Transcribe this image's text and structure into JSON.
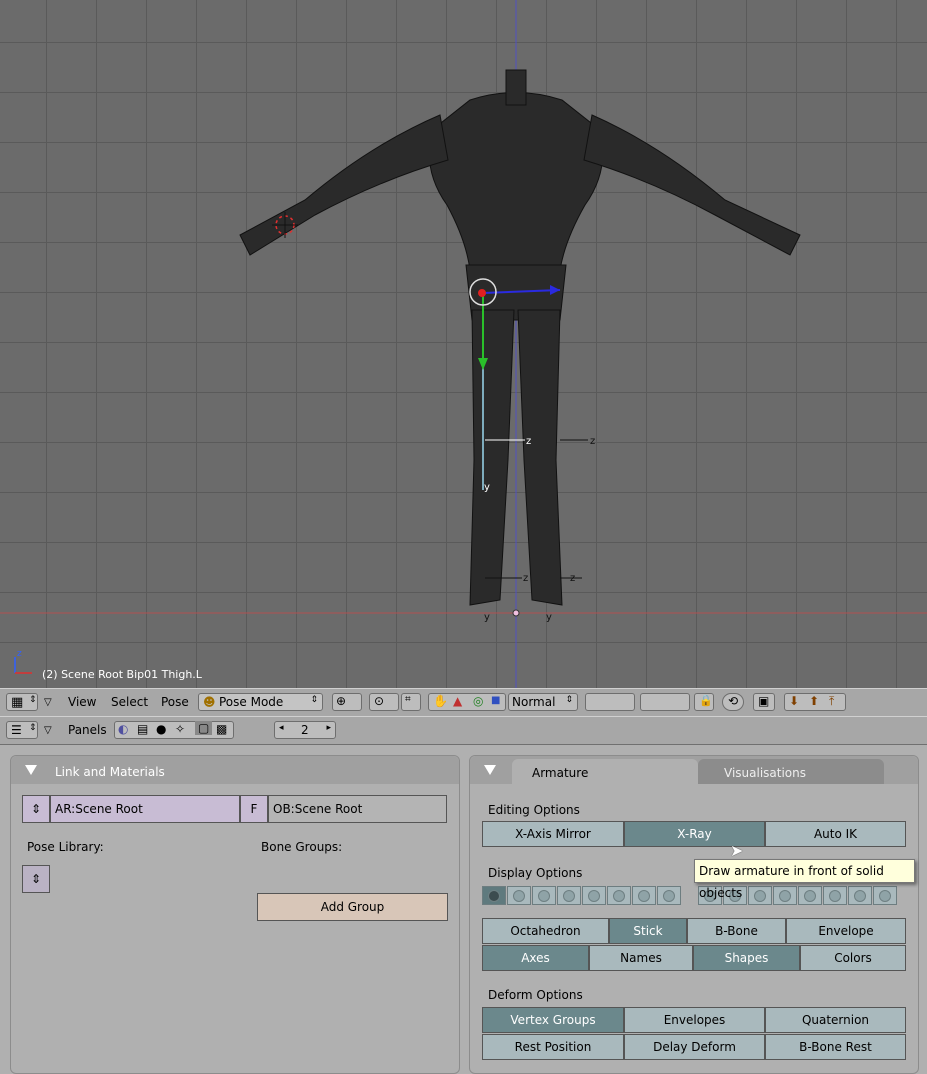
{
  "viewport": {
    "info_text": "(2) Scene Root Bip01 Thigh.L",
    "axis_labels": [
      "z",
      "z",
      "z",
      "z",
      "z",
      "y",
      "y",
      "y"
    ]
  },
  "header3d": {
    "menus": [
      "View",
      "Select",
      "Pose"
    ],
    "mode": "Pose Mode",
    "pivot": "Normal"
  },
  "buttons_header": {
    "panels_label": "Panels",
    "frame": "2"
  },
  "link_panel": {
    "title": "Link and Materials",
    "armature_name": "AR:Scene Root",
    "fake_user": "F",
    "object_name": "OB:Scene Root",
    "pose_library_label": "Pose Library:",
    "bone_groups_label": "Bone Groups:",
    "add_group": "Add Group"
  },
  "armature_panel": {
    "tabs": [
      "Armature",
      "Visualisations"
    ],
    "editing_label": "Editing Options",
    "editing_buttons": [
      "X-Axis Mirror",
      "X-Ray",
      "Auto IK"
    ],
    "tooltip": "Draw armature in front of solid objects",
    "display_label": "Display Options",
    "draw_types": [
      "Octahedron",
      "Stick",
      "B-Bone",
      "Envelope"
    ],
    "display_toggles": [
      "Axes",
      "Names",
      "Shapes",
      "Colors"
    ],
    "deform_label": "Deform Options",
    "deform_row1": [
      "Vertex Groups",
      "Envelopes",
      "Quaternion"
    ],
    "deform_row2": [
      "Rest Position",
      "Delay Deform",
      "B-Bone Rest"
    ]
  },
  "colors": {
    "viewport_bg": "#6b6b6b",
    "button_off": "#a9b9bd",
    "button_on": "#6b888c",
    "tooltip_bg": "#ffffdc"
  }
}
